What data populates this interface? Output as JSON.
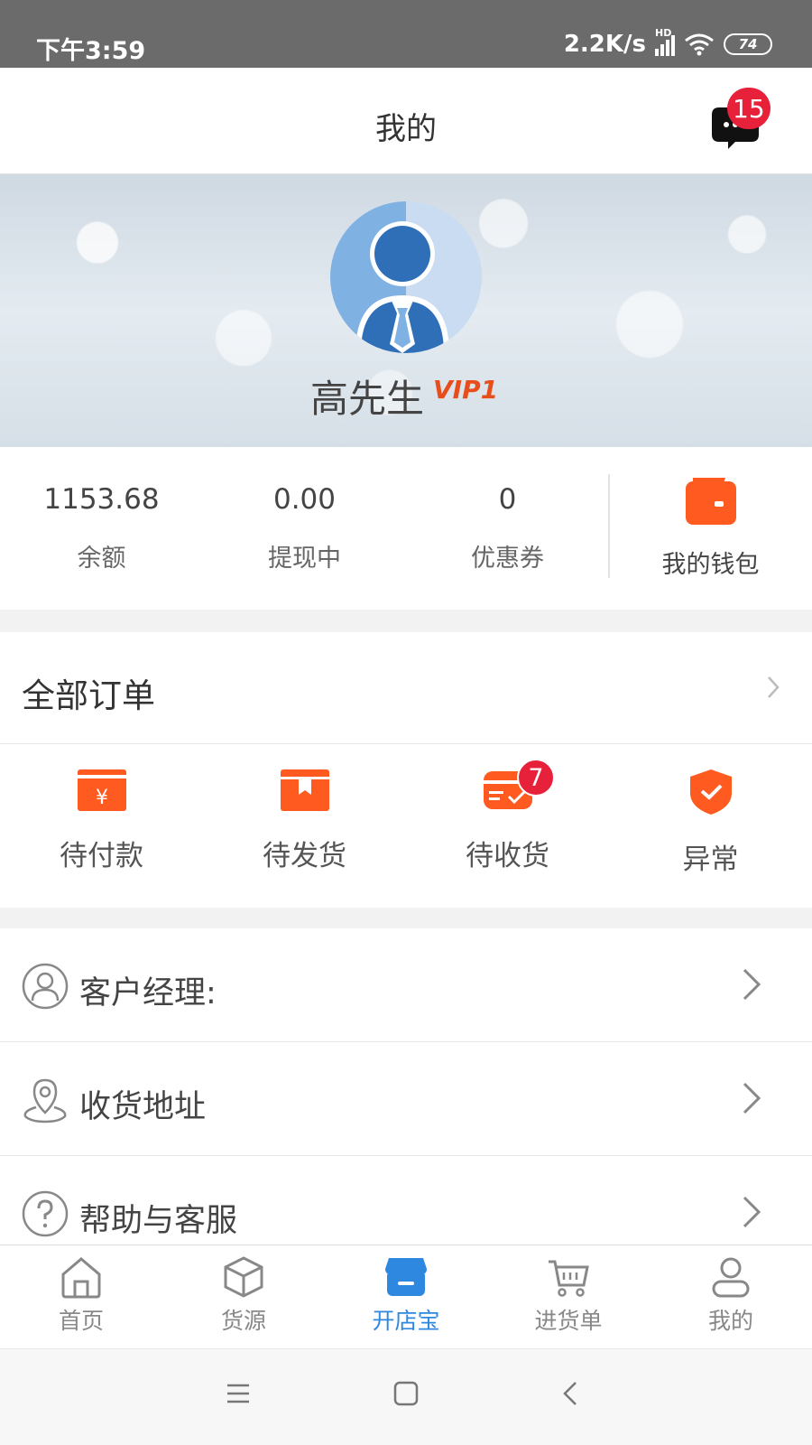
{
  "status_bar": {
    "time": "下午3:59",
    "network_speed": "2.2K/s",
    "signal_label": "HD",
    "battery": "74"
  },
  "header": {
    "title": "我的",
    "message_badge": "15"
  },
  "profile": {
    "name": "高先生",
    "vip": "VIP1"
  },
  "stats": [
    {
      "value": "1153.68",
      "label": "余额"
    },
    {
      "value": "0.00",
      "label": "提现中"
    },
    {
      "value": "0",
      "label": "优惠券"
    }
  ],
  "wallet": {
    "label": "我的钱包",
    "accent": "#ff5a1f"
  },
  "orders": {
    "title": "全部订单",
    "items": [
      {
        "label": "待付款",
        "icon": "payment-card-icon"
      },
      {
        "label": "待发货",
        "icon": "package-icon"
      },
      {
        "label": "待收货",
        "icon": "delivery-icon",
        "badge": "7"
      },
      {
        "label": "异常",
        "icon": "shield-alert-icon"
      }
    ]
  },
  "menu": [
    {
      "label": "客户经理:",
      "icon": "account-manager-icon"
    },
    {
      "label": "收货地址",
      "icon": "location-pin-icon"
    },
    {
      "label": "帮助与客服",
      "icon": "help-icon"
    }
  ],
  "tabs": [
    {
      "label": "首页",
      "icon": "home-icon"
    },
    {
      "label": "货源",
      "icon": "box-icon"
    },
    {
      "label": "开店宝",
      "icon": "store-icon",
      "active": true
    },
    {
      "label": "进货单",
      "icon": "cart-icon"
    },
    {
      "label": "我的",
      "icon": "user-icon"
    }
  ],
  "colors": {
    "accent_orange": "#ff5a1f",
    "badge_red": "#e8213a",
    "active_blue": "#2f88e0"
  }
}
